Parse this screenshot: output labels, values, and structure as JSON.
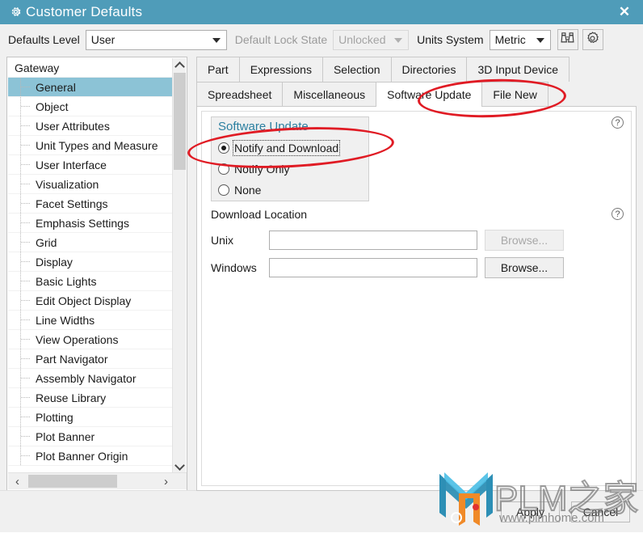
{
  "window": {
    "title": "Customer Defaults",
    "gear_icon": "gear-icon",
    "close_icon": "✕",
    "titlebar_color": "#4f9cb9"
  },
  "toolbar": {
    "defaults_level_label": "Defaults Level",
    "defaults_level_value": "User",
    "default_lock_state_label": "Default Lock State",
    "default_lock_state_value": "Unlocked",
    "units_system_label": "Units System",
    "units_system_value": "Metric",
    "find_icon": "binoculars-icon",
    "settings_icon": "gear-icon"
  },
  "tree": {
    "root": "Gateway",
    "selected": "General",
    "items": [
      "General",
      "Object",
      "User Attributes",
      "Unit Types and Measure",
      "User Interface",
      "Visualization",
      "Facet Settings",
      "Emphasis Settings",
      "Grid",
      "Display",
      "Basic Lights",
      "Edit Object Display",
      "Line Widths",
      "View Operations",
      "Part Navigator",
      "Assembly Navigator",
      "Reuse Library",
      "Plotting",
      "Plot Banner",
      "Plot Banner Origin"
    ],
    "scroll_left_icon": "‹",
    "scroll_right_icon": "›"
  },
  "tabs": {
    "row1": [
      "Part",
      "Expressions",
      "Selection",
      "Directories",
      "3D Input Device"
    ],
    "row2": [
      "Spreadsheet",
      "Miscellaneous",
      "Software Update",
      "File New"
    ],
    "active": "Software Update"
  },
  "panel": {
    "group_title": "Software Update",
    "group_title_color": "#2b7fa0",
    "radios": [
      {
        "label": "Notify and Download",
        "checked": true,
        "focused": true
      },
      {
        "label": "Notify Only",
        "checked": false,
        "focused": false
      },
      {
        "label": "None",
        "checked": false,
        "focused": false
      }
    ],
    "download_location_title": "Download Location",
    "fields": [
      {
        "label": "Unix",
        "value": "",
        "placeholder": "",
        "browse_label": "Browse...",
        "browse_enabled": false
      },
      {
        "label": "Windows",
        "value": "",
        "placeholder": "",
        "browse_label": "Browse...",
        "browse_enabled": true
      }
    ],
    "help_icon": "?"
  },
  "footer": {
    "apply_label": "Apply",
    "cancel_label": "Cancel"
  },
  "watermark": {
    "text": "PLM之家",
    "url": "www.plmhome.com",
    "logo_icon": "plm-home-logo"
  }
}
